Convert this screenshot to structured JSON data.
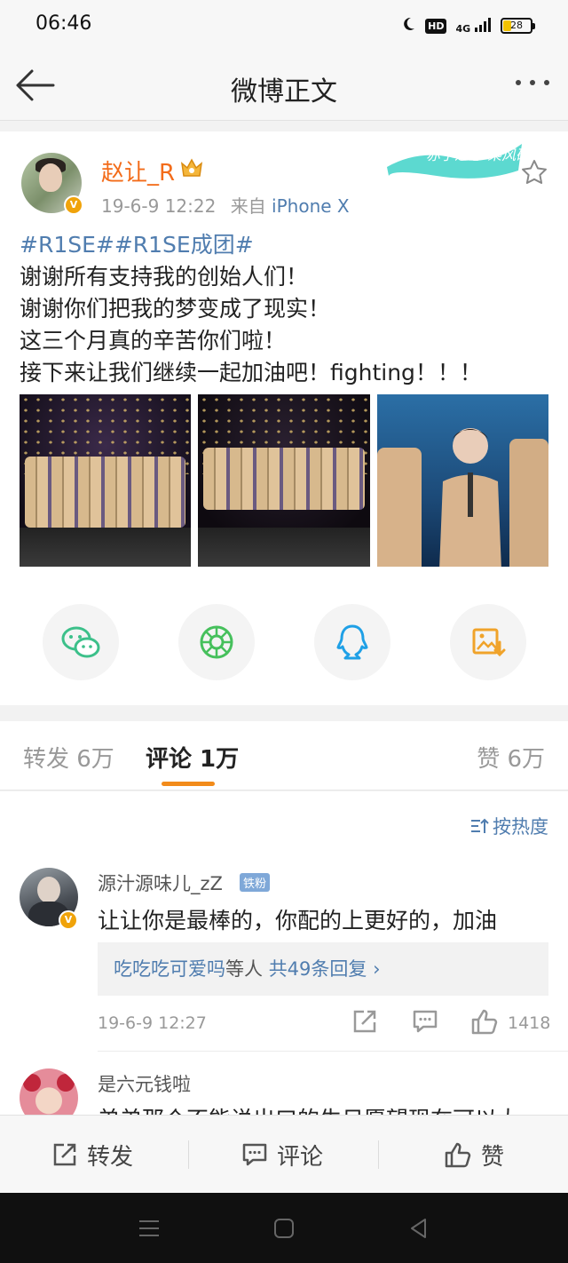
{
  "status_bar": {
    "time": "06:46",
    "hd": "HD",
    "network": "4G",
    "battery": "28"
  },
  "nav": {
    "title": "微博正文"
  },
  "post": {
    "username": "赵让_R",
    "date": "19-6-9 12:22",
    "from_label": "来自",
    "device": "iPhone X",
    "hashtags": "#R1SE##R1SE成团#",
    "lines": [
      "谢谢所有支持我的创始人们！",
      "谢谢你们把我的梦变成了现实！",
      "这三个月真的辛苦你们啦！",
      "接下来让我们继续一起加油吧！fighting！！！"
    ],
    "banner_text": "赤子之心 乘风破浪"
  },
  "tabs": {
    "repost": "转发 6万",
    "comment": "评论 1万",
    "like": "赞 6万"
  },
  "sort_label": "按热度",
  "comments": [
    {
      "name": "源汁源味儿_zZ",
      "badge": "铁粉",
      "text": "让让你是最棒的，你配的上更好的，加油",
      "reply_who": "吃吃吃可爱吗",
      "reply_mid": "等人",
      "reply_count": "共49条回复 ›",
      "time": "19-6-9 12:27",
      "likes": "1418"
    },
    {
      "name": "是六元钱啦",
      "text": "弟弟那个不能说出口的生日愿望现在可以大"
    }
  ],
  "action_bar": {
    "repost": "转发",
    "comment": "评论",
    "like": "赞"
  },
  "colors": {
    "accent_orange": "#f28b1a",
    "link_blue": "#507daf",
    "username_orange": "#f36c1a"
  }
}
